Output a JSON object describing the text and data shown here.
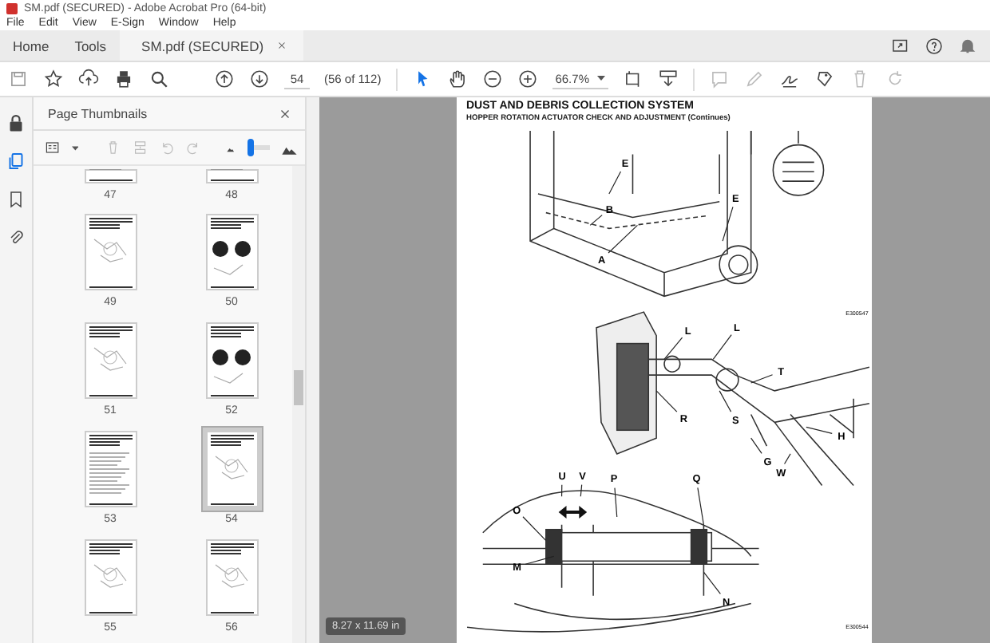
{
  "window": {
    "title": "SM.pdf (SECURED) - Adobe Acrobat Pro (64-bit)"
  },
  "menu": [
    "File",
    "Edit",
    "View",
    "E-Sign",
    "Window",
    "Help"
  ],
  "tabs": [
    {
      "label": "Home",
      "selected": false
    },
    {
      "label": "Tools",
      "selected": false
    },
    {
      "label": "SM.pdf (SECURED)",
      "selected": true
    }
  ],
  "toolbar": {
    "page": "54",
    "page_count": "(56 of 112)",
    "zoom": "66.7%"
  },
  "side_panel": {
    "title": "Page Thumbnails",
    "thumb_size": {
      "level": 0.1
    },
    "thumbnails": [
      {
        "label": "47",
        "selected": false,
        "kind": "text"
      },
      {
        "label": "48",
        "selected": false,
        "kind": "text"
      },
      {
        "label": "49",
        "selected": false,
        "kind": "drawing"
      },
      {
        "label": "50",
        "selected": false,
        "kind": "photo"
      },
      {
        "label": "51",
        "selected": false,
        "kind": "drawing"
      },
      {
        "label": "52",
        "selected": false,
        "kind": "photo"
      },
      {
        "label": "53",
        "selected": false,
        "kind": "text"
      },
      {
        "label": "54",
        "selected": true,
        "kind": "drawing"
      },
      {
        "label": "55",
        "selected": false,
        "kind": "drawing"
      },
      {
        "label": "56",
        "selected": false,
        "kind": "drawing"
      }
    ]
  },
  "document": {
    "heading": "DUST AND DEBRIS COLLECTION SYSTEM",
    "subheading": "HOPPER ROTATION ACTUATOR CHECK AND ADJUSTMENT (Continues)",
    "figures": [
      {
        "code": "E300547",
        "callouts": [
          "E",
          "B",
          "E",
          "A"
        ]
      },
      {
        "code": "E300544",
        "callouts": [
          "L",
          "L",
          "T",
          "R",
          "S",
          "H",
          "G",
          "W",
          "U",
          "V",
          "P",
          "Q",
          "O",
          "M",
          "N"
        ]
      }
    ]
  },
  "page_size": "8.27 x 11.69 in"
}
